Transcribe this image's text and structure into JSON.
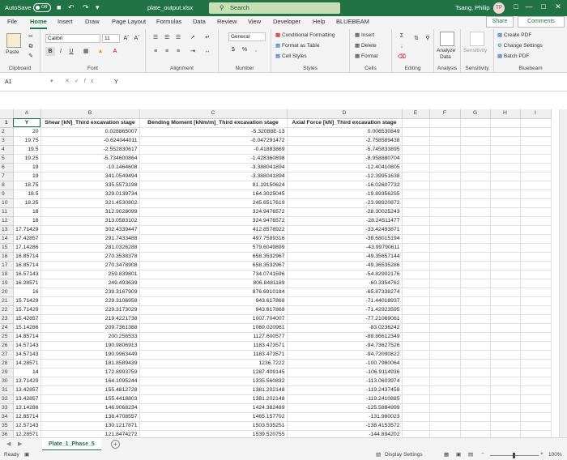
{
  "titlebar": {
    "autosave_label": "AutoSave",
    "autosave_state": "Off",
    "filename": "plate_output.xlsx",
    "search_placeholder": "Search",
    "user_name": "Tsang, Philip",
    "user_initials": "TP"
  },
  "tabs": [
    "File",
    "Home",
    "Insert",
    "Draw",
    "Page Layout",
    "Formulas",
    "Data",
    "Review",
    "View",
    "Developer",
    "Help",
    "BLUEBEAM"
  ],
  "active_tab": "Home",
  "share_label": "Share",
  "comments_label": "Comments",
  "ribbon": {
    "clipboard": {
      "label": "Clipboard",
      "paste": "Paste"
    },
    "font": {
      "label": "Font",
      "name": "Calibri",
      "size": "11"
    },
    "alignment": {
      "label": "Alignment"
    },
    "number": {
      "label": "Number",
      "format": "General"
    },
    "styles": {
      "label": "Styles",
      "conditional": "Conditional Formatting",
      "format_table": "Format as Table",
      "cell_styles": "Cell Styles"
    },
    "cells": {
      "label": "Cells",
      "insert": "Insert",
      "delete": "Delete",
      "format": "Format"
    },
    "editing": {
      "label": "Editing"
    },
    "analysis": {
      "label": "Analysis",
      "analyze": "Analyze",
      "analyze2": "Data"
    },
    "sensitivity": {
      "label": "Sensitivity",
      "button": "Sensitivity"
    },
    "bluebeam": {
      "label": "Bluebeam",
      "create": "Create PDF",
      "change": "Change Settings",
      "batch": "Batch PDF"
    }
  },
  "formula_bar": {
    "name_box": "A1",
    "content": "Y"
  },
  "columns": [
    "A",
    "B",
    "C",
    "D",
    "E",
    "F",
    "G",
    "H",
    "I"
  ],
  "headers": [
    "Y",
    "Shear [kN]_Third excavation stage",
    "Bending Moment [kNm/m]_Third excavation stage",
    "Axial Force [kN]_Third excavation stage"
  ],
  "rows": [
    [
      "20",
      "0.028865007",
      "-5.32088E-13",
      "0.006530849"
    ],
    [
      "19.75",
      "-0.624044011",
      "-0.047291472",
      "-2.758589438"
    ],
    [
      "19.5",
      "-2.552830617",
      "-0.41883869",
      "-5.745833895"
    ],
    [
      "19.25",
      "-5.734600864",
      "-1.428360898",
      "-8.958880704"
    ],
    [
      "19",
      "-10.1464608",
      "-3.388041894",
      "-12.40410805"
    ],
    [
      "19",
      "341.0549494",
      "-3.388041894",
      "-12.39951638"
    ],
    [
      "18.75",
      "335.5573198",
      "81.19150624",
      "-16.02607732"
    ],
    [
      "18.5",
      "329.0139734",
      "164.3025045",
      "-19.89356255"
    ],
    [
      "18.25",
      "321.4530802",
      "245.6517619",
      "-23.98920872"
    ],
    [
      "18",
      "312.9028099",
      "324.9476572",
      "-28.30025243"
    ],
    [
      "18",
      "313.0583102",
      "324.9476572",
      "-28.24511477"
    ],
    [
      "17.71429",
      "302.4339447",
      "412.8578922",
      "-33.42493871"
    ],
    [
      "17.42857",
      "291.7433488",
      "497.7589316",
      "-38.68015194"
    ],
    [
      "17.14286",
      "281.0326288",
      "579.6049899",
      "-43.99790611"
    ],
    [
      "16.85714",
      "270.3538378",
      "658.3532967",
      "-49.35657144"
    ],
    [
      "16.85714",
      "270.3478908",
      "658.3532967",
      "-49.36535286"
    ],
    [
      "16.57143",
      "259.839801",
      "734.0741596",
      "-54.82902176"
    ],
    [
      "16.28571",
      "249.493639",
      "806.8481189",
      "-60.3354762"
    ],
    [
      "16",
      "239.3167909",
      "876.6910184",
      "-65.87338274"
    ],
    [
      "15.71429",
      "229.3106958",
      "943.617868",
      "-71.44018937"
    ],
    [
      "15.71429",
      "229.3173029",
      "943.617868",
      "-71.42923595"
    ],
    [
      "15.42857",
      "219.4221738",
      "1007.704007",
      "-77.21069061"
    ],
    [
      "15.14286",
      "209.7361388",
      "1069.020961",
      "-83.0236242"
    ],
    [
      "14.85714",
      "200.256533",
      "1127.600577",
      "-88.86612349"
    ],
    [
      "14.57143",
      "190.9806913",
      "1183.473571",
      "-94.73627526"
    ],
    [
      "14.57143",
      "190.9963449",
      "1183.473571",
      "-94.72090822"
    ],
    [
      "14.28571",
      "181.8589439",
      "1236.7222",
      "-100.7980064"
    ],
    [
      "14",
      "172.8993759",
      "1287.409145",
      "-106.9114936"
    ],
    [
      "13.71429",
      "164.1095244",
      "1335.560832",
      "-113.0603974"
    ],
    [
      "13.42857",
      "155.4812728",
      "1381.202148",
      "-119.2437458"
    ],
    [
      "13.42857",
      "155.4418803",
      "1381.202148",
      "-119.2410885"
    ],
    [
      "13.14286",
      "146.9068234",
      "1424.382489",
      "-125.5884999"
    ],
    [
      "12.85714",
      "138.4708557",
      "1465.157702",
      "-131.980023"
    ],
    [
      "12.57143",
      "130.1217871",
      "1503.535251",
      "-138.4153572"
    ],
    [
      "12.28571",
      "121.8474272",
      "1539.520755",
      "-144.894202"
    ]
  ],
  "sheet_tab": "Plate_1_Phase_5",
  "status": {
    "ready": "Ready",
    "display": "Display Settings",
    "zoom": "100%"
  }
}
